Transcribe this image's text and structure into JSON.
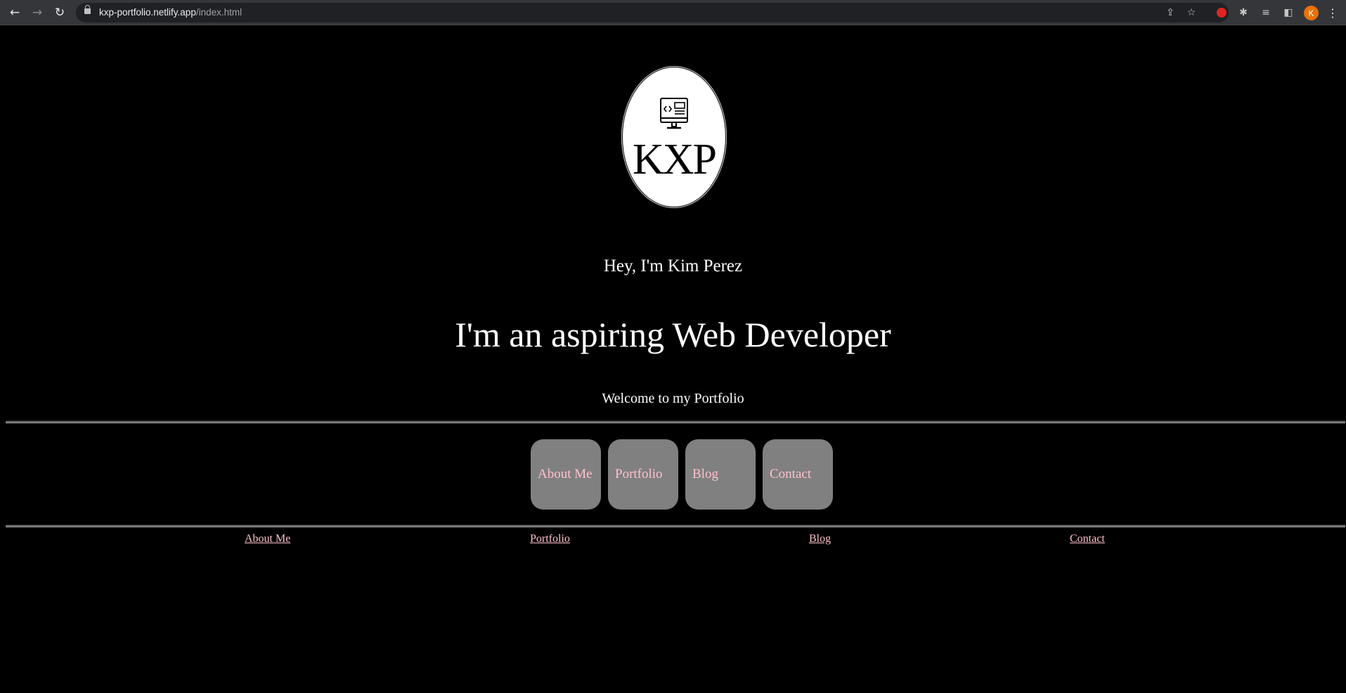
{
  "browser": {
    "url_host": "kxp-portfolio.netlify.app",
    "url_path": "/index.html",
    "avatar_letter": "K",
    "icons": [
      "back-icon",
      "forward-icon",
      "reload-icon",
      "lock-icon",
      "share-icon",
      "star-icon",
      "extension-red-icon",
      "puzzle-icon",
      "media-queue-icon",
      "side-panel-icon",
      "menu-icon"
    ]
  },
  "logo": {
    "text": "KXP"
  },
  "hero": {
    "greeting": "Hey, I'm Kim Perez",
    "headline": "I'm an aspiring Web Developer",
    "welcome": "Welcome to my Portfolio"
  },
  "nav_buttons": [
    {
      "label": "About Me"
    },
    {
      "label": "Portfolio"
    },
    {
      "label": "Blog"
    },
    {
      "label": "Contact"
    }
  ],
  "footer_links": [
    {
      "label": "About Me"
    },
    {
      "label": "Portfolio"
    },
    {
      "label": "Blog"
    },
    {
      "label": "Contact"
    }
  ],
  "colors": {
    "background": "#000000",
    "button_bg": "#808080",
    "link_pink": "#ffc0cb",
    "text": "#ffffff"
  }
}
